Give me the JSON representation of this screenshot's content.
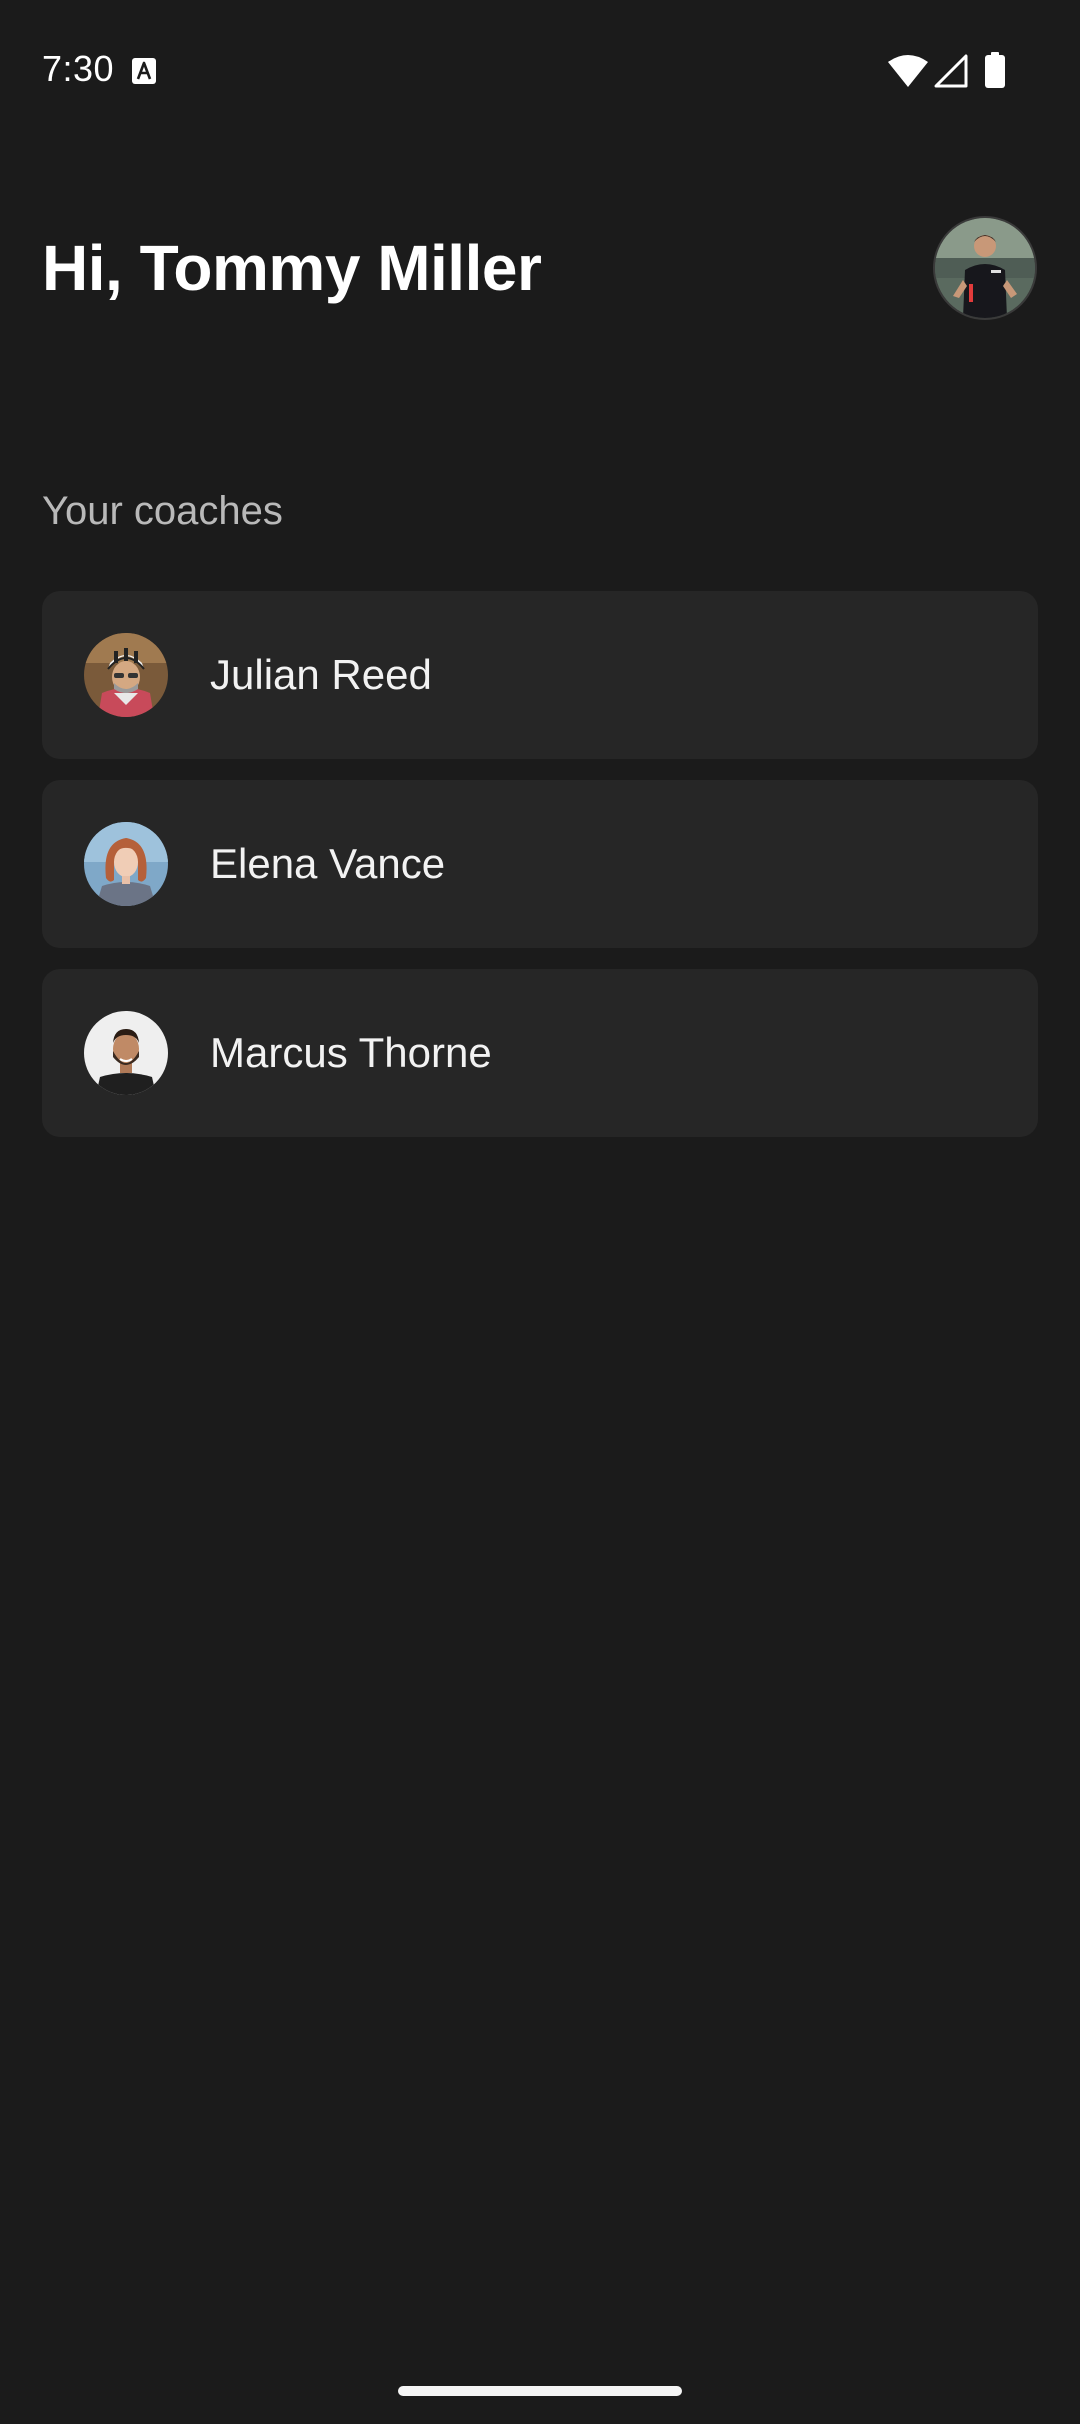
{
  "status_bar": {
    "time": "7:30",
    "icons": [
      "a-keyboard-icon",
      "wifi-icon",
      "signal-icon",
      "battery-icon"
    ]
  },
  "header": {
    "greeting": "Hi, Tommy Miller",
    "profile_avatar": "profile-avatar"
  },
  "coaches_section": {
    "label": "Your coaches",
    "coaches": [
      {
        "name": "Julian Reed",
        "avatar": "coach-avatar-helmet"
      },
      {
        "name": "Elena Vance",
        "avatar": "coach-avatar-redhair"
      },
      {
        "name": "Marcus Thorne",
        "avatar": "coach-avatar-beard"
      }
    ]
  },
  "colors": {
    "background": "#1b1b1b",
    "card": "#262626",
    "text_primary": "#ffffff",
    "text_secondary": "#b9b9b9"
  }
}
